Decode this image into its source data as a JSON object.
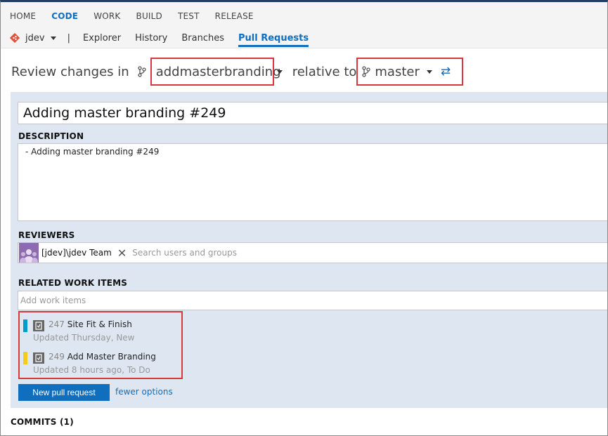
{
  "hubs": [
    "HOME",
    "CODE",
    "WORK",
    "BUILD",
    "TEST",
    "RELEASE"
  ],
  "active_hub": "CODE",
  "repo": "jdev",
  "separator": "|",
  "subnav": [
    "Explorer",
    "History",
    "Branches",
    "Pull Requests"
  ],
  "active_subnav": "Pull Requests",
  "review": {
    "prefix": "Review changes in",
    "source_branch": "addmasterbranding",
    "middle": "relative to",
    "target_branch": "master",
    "swap_glyph": "⇄"
  },
  "form": {
    "title_value": "Adding master branding #249",
    "description_label": "DESCRIPTION",
    "description_value": "- Adding master branding #249",
    "reviewers_label": "REVIEWERS",
    "reviewer_name": "[jdev]\\jdev Team",
    "remove_glyph": "✕",
    "reviewers_placeholder": "Search users and groups",
    "work_items_label": "RELATED WORK ITEMS",
    "work_items_placeholder": "Add work items",
    "work_items": [
      {
        "id": "247",
        "title": "Site Fit & Finish",
        "updated": "Updated Thursday, New",
        "color": "#009ccc"
      },
      {
        "id": "249",
        "title": "Add Master Branding",
        "updated": "Updated 8 hours ago, To Do",
        "color": "#f2cb1d"
      }
    ],
    "new_pr_label": "New pull request",
    "fewer_options_label": "fewer options"
  },
  "commits_label": "COMMITS (1)",
  "colors": {
    "accent": "#106ebe",
    "highlight": "#d9363e",
    "panel": "#dde6f1"
  }
}
